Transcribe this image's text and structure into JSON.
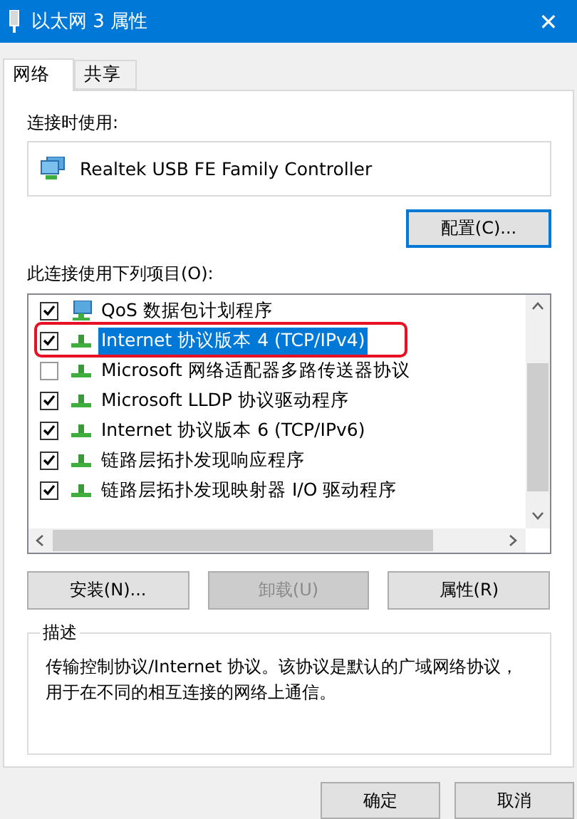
{
  "window": {
    "title": "以太网 3 属性",
    "close": "✕"
  },
  "tabs": [
    {
      "label": "网络",
      "selected": true
    },
    {
      "label": "共享",
      "selected": false
    }
  ],
  "connect_using": {
    "label": "连接时使用:",
    "adapter": "Realtek USB FE Family Controller",
    "configure_button": "配置(C)..."
  },
  "items_label": "此连接使用下列项目(O):",
  "items": [
    {
      "kind": "scheduler",
      "label": "QoS 数据包计划程序",
      "checked": true,
      "selected": false,
      "highlight": false
    },
    {
      "kind": "protocol",
      "label": "Internet 协议版本 4 (TCP/IPv4)",
      "checked": true,
      "selected": true,
      "highlight": true
    },
    {
      "kind": "protocol",
      "label": "Microsoft 网络适配器多路传送器协议",
      "checked": false,
      "selected": false,
      "highlight": false
    },
    {
      "kind": "protocol",
      "label": "Microsoft LLDP 协议驱动程序",
      "checked": true,
      "selected": false,
      "highlight": false
    },
    {
      "kind": "protocol",
      "label": "Internet 协议版本 6 (TCP/IPv6)",
      "checked": true,
      "selected": false,
      "highlight": false
    },
    {
      "kind": "protocol",
      "label": "链路层拓扑发现响应程序",
      "checked": true,
      "selected": false,
      "highlight": false
    },
    {
      "kind": "protocol",
      "label": "链路层拓扑发现映射器 I/O 驱动程序",
      "checked": true,
      "selected": false,
      "highlight": false
    }
  ],
  "item_buttons": [
    {
      "label": "安装(N)...",
      "disabled": false
    },
    {
      "label": "卸载(U)",
      "disabled": true
    },
    {
      "label": "属性(R)",
      "disabled": false
    }
  ],
  "description": {
    "title": "描述",
    "text": "传输控制协议/Internet 协议。该协议是默认的广域网络协议，用于在不同的相互连接的网络上通信。"
  },
  "dialog_buttons": [
    "确定",
    "取消"
  ]
}
